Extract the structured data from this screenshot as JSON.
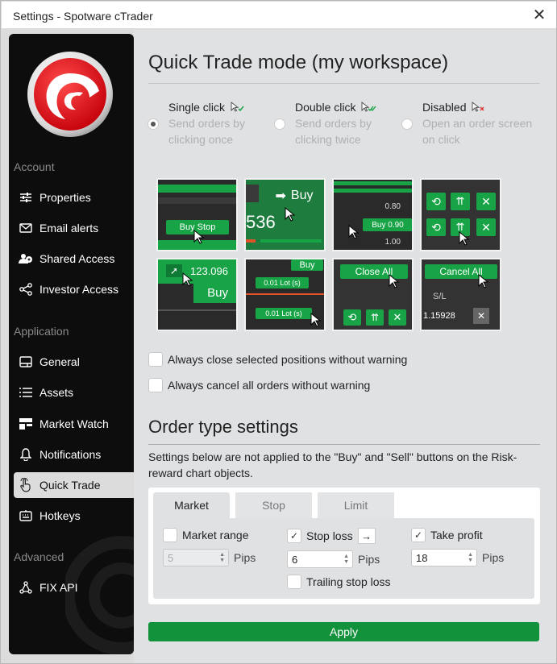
{
  "window": {
    "title": "Settings - Spotware cTrader"
  },
  "sidebar": {
    "sections": [
      {
        "label": "Account"
      },
      {
        "label": "Application"
      },
      {
        "label": "Advanced"
      }
    ],
    "items": [
      {
        "label": "Properties",
        "icon": "sliders-icon"
      },
      {
        "label": "Email alerts",
        "icon": "envelope-icon"
      },
      {
        "label": "Shared Access",
        "icon": "users-icon"
      },
      {
        "label": "Investor Access",
        "icon": "share-icon"
      },
      {
        "label": "General",
        "icon": "general-icon"
      },
      {
        "label": "Assets",
        "icon": "list-icon"
      },
      {
        "label": "Market Watch",
        "icon": "market-watch-icon"
      },
      {
        "label": "Notifications",
        "icon": "bell-icon"
      },
      {
        "label": "Quick Trade",
        "icon": "pointer-icon",
        "active": true
      },
      {
        "label": "Hotkeys",
        "icon": "keyboard-icon"
      },
      {
        "label": "FIX API",
        "icon": "network-icon"
      }
    ]
  },
  "quick_trade": {
    "heading": "Quick Trade mode (my workspace)",
    "modes": [
      {
        "title": "Single click",
        "desc": "Send orders by clicking once",
        "selected": true
      },
      {
        "title": "Double click",
        "desc": "Send orders by clicking twice",
        "selected": false
      },
      {
        "title": "Disabled",
        "desc": "Open an order screen on click",
        "selected": false
      }
    ],
    "thumbs": {
      "buy_stop": "Buy Stop",
      "buy": "Buy",
      "price_536": "536",
      "p080": "0.80",
      "buy090": "Buy 0.90",
      "p100": "1.00",
      "p123": "123.096",
      "buy2": "Buy",
      "buy3": "Buy",
      "lot1": "0.01 Lot (s)",
      "lot2": "0.01 Lot (s)",
      "close_all": "Close All",
      "cancel_all": "Cancel All",
      "sl": "S/L",
      "p115": "1.15928"
    },
    "options": [
      {
        "label": "Always close selected positions without warning",
        "checked": false
      },
      {
        "label": "Always cancel all orders without warning",
        "checked": false
      }
    ]
  },
  "order_type": {
    "heading": "Order type settings",
    "note": "Settings below are not applied to the \"Buy\" and \"Sell\" buttons on the Risk-reward chart objects.",
    "tabs": [
      {
        "label": "Market",
        "active": true
      },
      {
        "label": "Stop",
        "active": false
      },
      {
        "label": "Limit",
        "active": false
      }
    ],
    "market_range": {
      "label": "Market range",
      "checked": false,
      "value": "5",
      "unit": "Pips"
    },
    "stop_loss": {
      "label": "Stop loss",
      "checked": true,
      "value": "6",
      "unit": "Pips"
    },
    "take_profit": {
      "label": "Take profit",
      "checked": true,
      "value": "18",
      "unit": "Pips"
    },
    "trailing": {
      "label": "Trailing stop loss",
      "checked": false
    }
  },
  "apply_label": "Apply",
  "colors": {
    "green": "#17a346",
    "apply": "#12923b",
    "logo_red": "#e31b23"
  }
}
